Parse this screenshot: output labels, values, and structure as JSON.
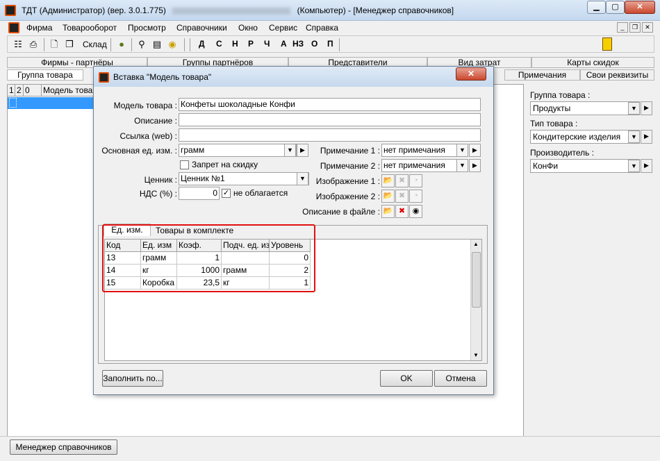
{
  "window": {
    "title": "ТДТ  (Администратор) (вер. 3.0.1.775)",
    "title_suffix": "(Компьютер) - [Менеджер справочников]"
  },
  "menu": [
    "Фирма",
    "Товарооборот",
    "Просмотр",
    "Справочники",
    "Окно",
    "Сервис",
    "Справка"
  ],
  "toolbar": {
    "sklad_label": "Склад",
    "letters": [
      "Д",
      "С",
      "Н",
      "Р",
      "Ч",
      "А",
      "НЗ",
      "О",
      "П"
    ]
  },
  "tabs_row1": [
    "Фирмы - партнёры",
    "Группы партнёров",
    "Представители",
    "Вид затрат",
    "Карты скидок"
  ],
  "tabs_row2": [
    "Группа товара",
    "Примечания",
    "Свои реквизиты"
  ],
  "left_grid": {
    "headers": [
      "1",
      "2",
      "0",
      "Модель товар"
    ]
  },
  "right_panel": {
    "group_label": "Группа товара :",
    "group_value": "Продукты",
    "type_label": "Тип товара :",
    "type_value": "Кондитерские изделия",
    "maker_label": "Производитель :",
    "maker_value": "КонФи"
  },
  "dialog": {
    "title": "Вставка \"Модель товара\"",
    "model_label": "Модель товара :",
    "model_value": "Конфеты шоколадные Конфи",
    "desc_label": "Описание :",
    "desc_value": "",
    "link_label": "Ссылка (web) :",
    "link_value": "",
    "unit_label": "Основная ед. изм. :",
    "unit_value": "грамм",
    "discount_label": "Запрет на скидку",
    "price_label": "Ценник :",
    "price_value": "Ценник №1",
    "vat_label": "НДС (%) :",
    "vat_value": "0",
    "vat_check_label": "не облагается",
    "note1_label": "Примечание 1 :",
    "note1_value": "нет примечания",
    "note2_label": "Примечание 2 :",
    "note2_value": "нет примечания",
    "img1_label": "Изображение 1 :",
    "img2_label": "Изображение 2 :",
    "descfile_label": "Описание в файле :",
    "tabs": [
      "Ед. изм.",
      "Товары в комплекте"
    ],
    "grid_headers": [
      "Код",
      "Ед. изм",
      "Коэф.",
      "Подч. ед. изм",
      "Уровень"
    ],
    "grid_rows": [
      [
        "13",
        "грамм",
        "1",
        "",
        "0"
      ],
      [
        "14",
        "кг",
        "1000",
        "грамм",
        "2"
      ],
      [
        "15",
        "Коробка",
        "23,5",
        "кг",
        "1"
      ]
    ],
    "fill_button": "Заполнить по...",
    "ok_button": "OK",
    "cancel_button": "Отмена"
  },
  "statusbar": {
    "task_label": "Менеджер справочников"
  },
  "colors": {
    "accent": "#3399ff",
    "highlight_red": "#e01010"
  }
}
